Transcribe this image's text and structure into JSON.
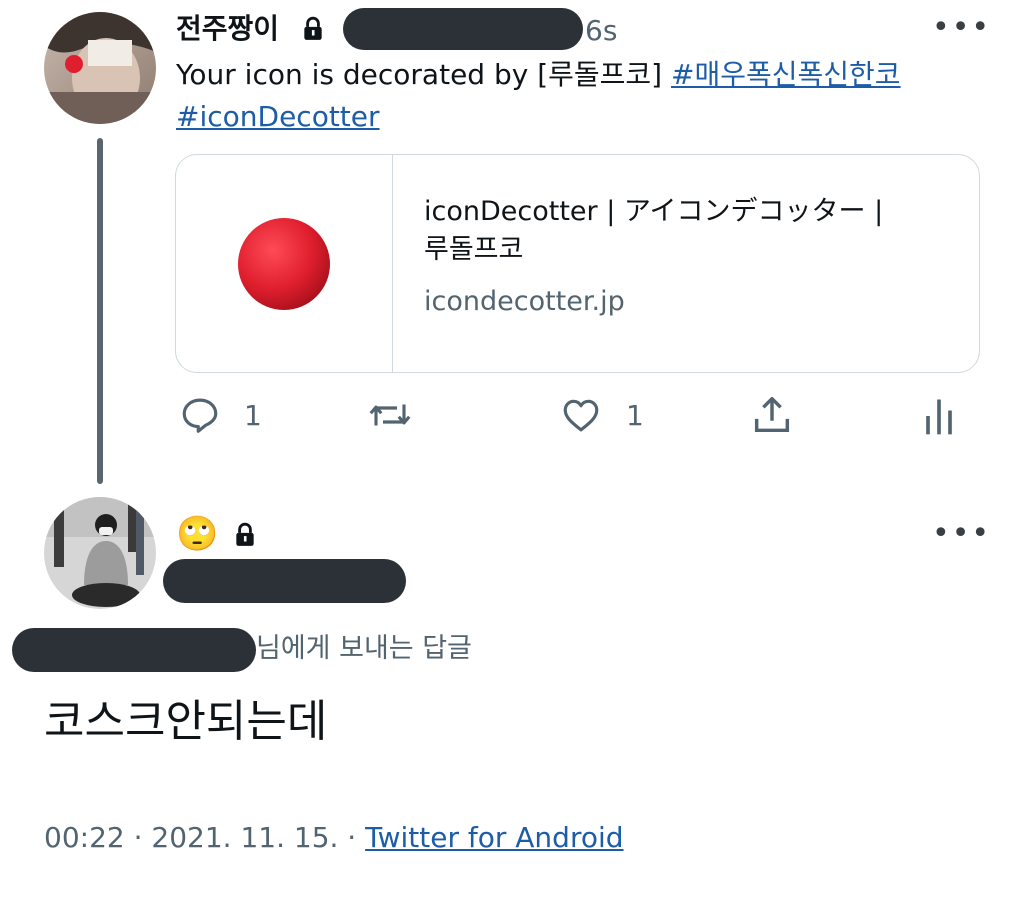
{
  "tweet": {
    "display_name": "전주짱이",
    "time": "6s",
    "text_plain": "Your icon is decorated by [루돌프코] ",
    "hashtag_1": "#매우폭신폭신한코",
    "hashtag_2": "#iconDecotter",
    "card": {
      "title_line1": "iconDecotter | アイコンデコッター |",
      "title_line2": "루돌프코",
      "domain": "icondecotter.jp"
    },
    "actions": {
      "reply_count": "1",
      "like_count": "1"
    }
  },
  "reply": {
    "emoji": "🙄",
    "replying_to_suffix": "님에게 보내는 답글",
    "text": "코스크안되는데",
    "timestamp": "00:22 · 2021. 11. 15. · ",
    "source": "Twitter for Android"
  },
  "icons": {
    "lock": "lock-icon",
    "more": "more-icon",
    "reply": "reply-icon",
    "retweet": "retweet-icon",
    "like": "heart-icon",
    "share": "share-icon",
    "analytics": "analytics-icon"
  },
  "colors": {
    "link": "#1d5da8",
    "redaction": "#2b3136",
    "muted": "#536471",
    "clown_nose": "#e01f2e"
  }
}
